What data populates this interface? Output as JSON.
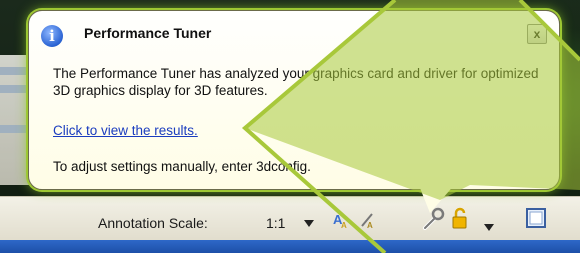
{
  "balloon": {
    "title": "Performance Tuner",
    "close_label": "x",
    "info_glyph": "i",
    "body": "The Performance Tuner has analyzed your graphics card and driver for optimized 3D graphics display for 3D features.",
    "link": "Click to view the results.",
    "footer": "To adjust settings manually, enter 3dconfig."
  },
  "status_bar": {
    "annotation_label": "Annotation Scale:",
    "annotation_value": "1:1"
  },
  "icons": {
    "info": "info-icon",
    "annotation_scale": "annotation-scale-icon",
    "annotation_visibility": "annotation-visibility-icon",
    "performance_tuner": "wrench-icon",
    "lock": "lock-icon",
    "menu": "chevron-down-icon",
    "clean_screen": "clean-screen-icon"
  },
  "colors": {
    "highlight": "#a8c83a",
    "link": "#1a3cbf"
  }
}
